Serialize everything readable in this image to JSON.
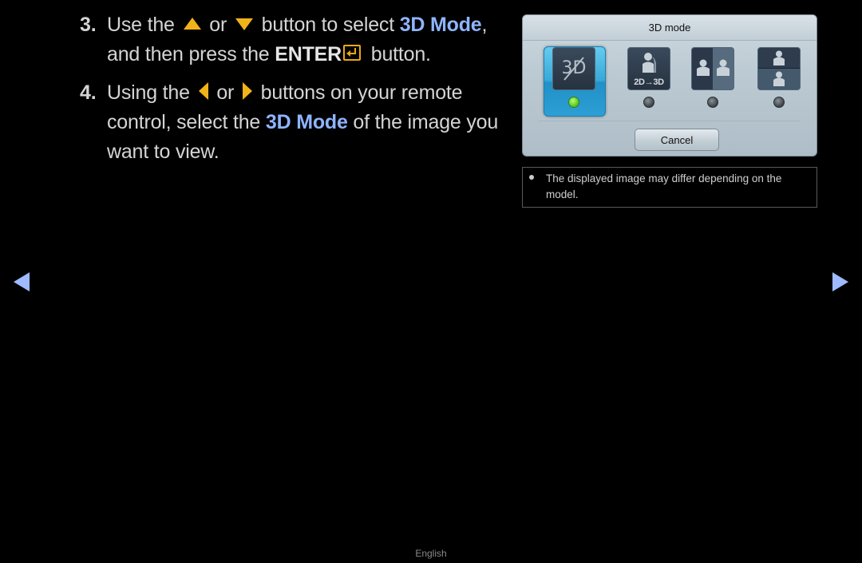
{
  "instructions": {
    "step3": {
      "number": "3.",
      "part1": "Use the",
      "or": "or",
      "part2": "button to select",
      "highlight": "3D Mode",
      "comma": ",",
      "part3": "and then press the",
      "enter_label": "ENTER",
      "part4": "button.",
      "icons": [
        "up-arrow-icon",
        "down-arrow-icon",
        "enter-icon"
      ]
    },
    "step4": {
      "number": "4.",
      "part1": "Using the",
      "or": "or",
      "part2": "buttons on your remote control, select the",
      "highlight": "3D Mode",
      "part3": "of the image you want to view.",
      "icons": [
        "left-arrow-icon",
        "right-arrow-icon"
      ]
    }
  },
  "dialog": {
    "title": "3D mode",
    "modes": [
      {
        "name": "3D off",
        "tile_text": "3D",
        "selected": true
      },
      {
        "name": "2D to 3D",
        "tile_text": "2D→3D",
        "selected": false
      },
      {
        "name": "Side by Side",
        "tile_text": "",
        "selected": false
      },
      {
        "name": "Top & Bottom",
        "tile_text": "",
        "selected": false
      }
    ],
    "cancel_label": "Cancel"
  },
  "note": {
    "text": "The displayed image may differ depending on the model."
  },
  "nav": {
    "prev": "previous-page",
    "next": "next-page"
  },
  "footer": {
    "language": "English"
  },
  "colors": {
    "highlight": "#8fb4ff",
    "remote_button": "#f0b31a",
    "selected_mode": "#39a9d8",
    "nav_arrow": "#9fbaff"
  }
}
